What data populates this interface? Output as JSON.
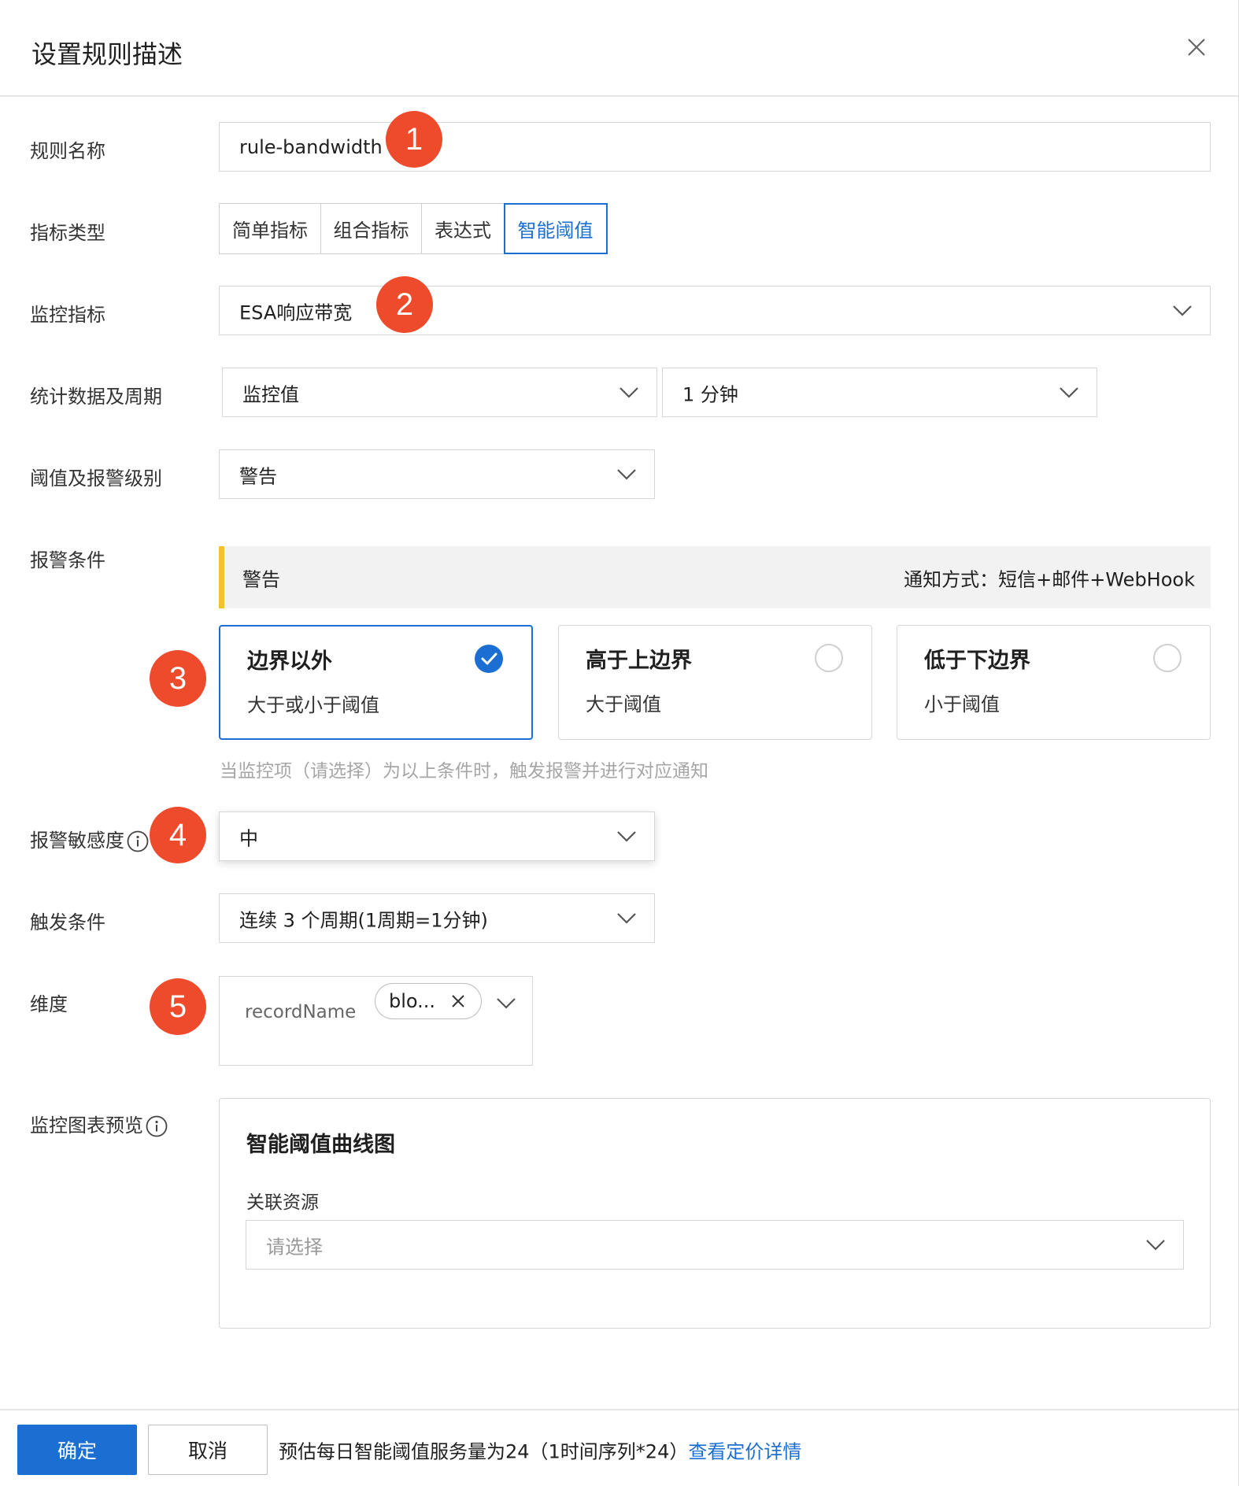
{
  "dialog": {
    "title": "设置规则描述",
    "close_icon": "close-icon"
  },
  "rule_name": {
    "label": "规则名称",
    "value": "rule-bandwidth",
    "badge": "1"
  },
  "metric_type": {
    "label": "指标类型",
    "options": [
      "简单指标",
      "组合指标",
      "表达式",
      "智能阈值"
    ],
    "selected": "智能阈值"
  },
  "monitor_metric": {
    "label": "监控指标",
    "value": "ESA响应带宽",
    "badge": "2"
  },
  "stat_period": {
    "label": "统计数据及周期",
    "stat_value": "监控值",
    "period_value": "1 分钟"
  },
  "threshold_level": {
    "label": "阈值及报警级别",
    "value": "警告"
  },
  "alert_condition": {
    "label": "报警条件",
    "level": "警告",
    "notify": "通知方式：短信+邮件+WebHook",
    "badge": "3",
    "cards": [
      {
        "title": "边界以外",
        "subtitle": "大于或小于阈值",
        "selected": true
      },
      {
        "title": "高于上边界",
        "subtitle": "大于阈值",
        "selected": false
      },
      {
        "title": "低于下边界",
        "subtitle": "小于阈值",
        "selected": false
      }
    ],
    "hint": "当监控项（请选择）为以上条件时，触发报警并进行对应通知"
  },
  "sensitivity": {
    "label": "报警敏感度",
    "value": "中",
    "badge": "4"
  },
  "trigger": {
    "label": "触发条件",
    "value": "连续 3 个周期(1周期=1分钟)"
  },
  "dimension": {
    "label": "维度",
    "key": "recordName",
    "tag_value": "blo...",
    "badge": "5"
  },
  "chart_preview": {
    "label": "监控图表预览",
    "title": "智能阈值曲线图",
    "resource_label": "关联资源",
    "resource_placeholder": "请选择"
  },
  "footer": {
    "confirm": "确定",
    "cancel": "取消",
    "estimate": "预估每日智能阈值服务量为24（1时间序列*24）",
    "pricing_link": "查看定价详情"
  },
  "colors": {
    "primary": "#1b6fd3",
    "badge": "#ee4a2c",
    "warning_bar": "#f5c22f"
  }
}
